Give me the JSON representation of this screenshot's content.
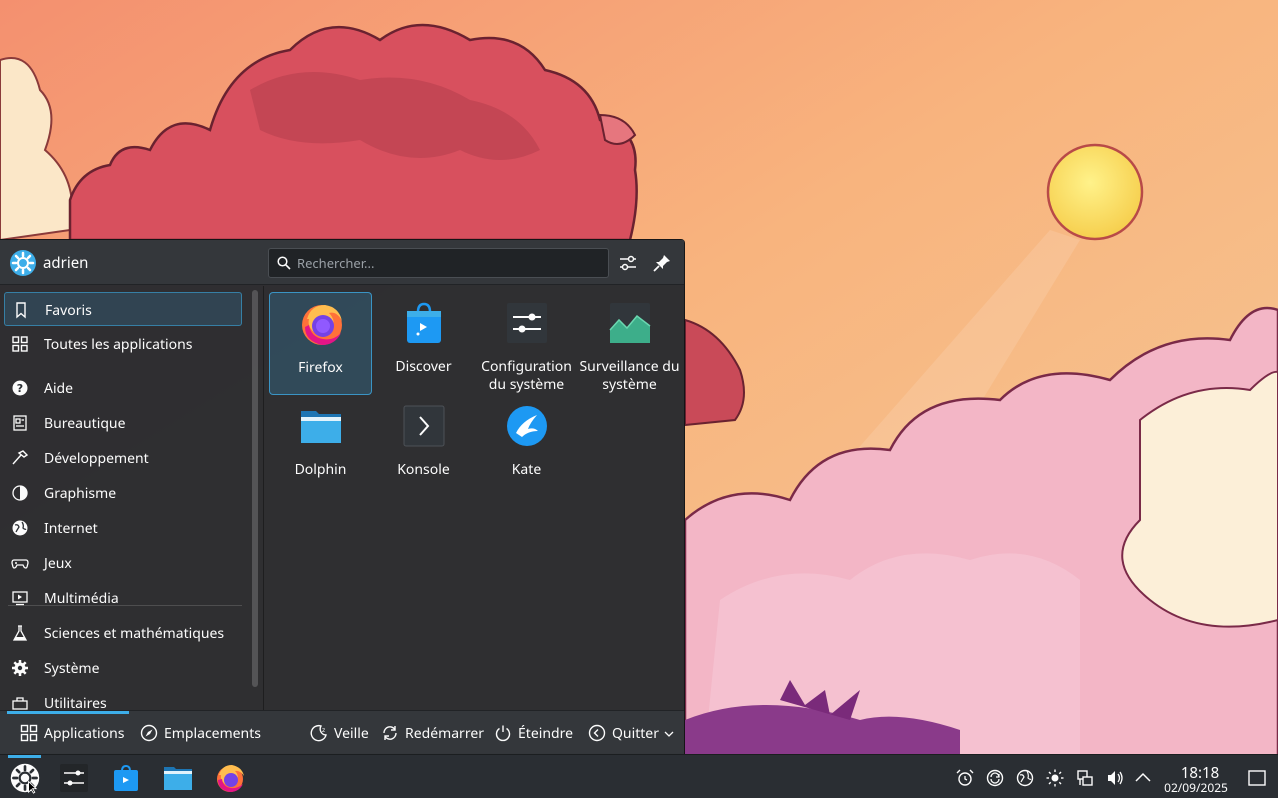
{
  "launcher": {
    "user_name": "adrien",
    "search": {
      "placeholder": "Rechercher..."
    },
    "categories": [
      {
        "label": "Favoris",
        "icon": "bookmark-icon"
      },
      {
        "label": "Toutes les applications",
        "icon": "grid-icon"
      },
      {
        "label": "Aide",
        "icon": "help-icon"
      },
      {
        "label": "Bureautique",
        "icon": "office-icon"
      },
      {
        "label": "Développement",
        "icon": "hammer-icon"
      },
      {
        "label": "Graphisme",
        "icon": "graphics-icon"
      },
      {
        "label": "Internet",
        "icon": "globe-icon"
      },
      {
        "label": "Jeux",
        "icon": "gamepad-icon"
      },
      {
        "label": "Multimédia",
        "icon": "multimedia-icon"
      },
      {
        "label": "Sciences et mathématiques",
        "icon": "flask-icon"
      },
      {
        "label": "Système",
        "icon": "gear-icon"
      },
      {
        "label": "Utilitaires",
        "icon": "utilities-icon"
      }
    ],
    "apps": [
      {
        "label": "Firefox",
        "icon": "firefox-icon"
      },
      {
        "label": "Discover",
        "icon": "discover-icon"
      },
      {
        "label": "Configuration du système",
        "icon": "system-settings-icon"
      },
      {
        "label": "Surveillance du système",
        "icon": "system-monitor-icon"
      },
      {
        "label": "Dolphin",
        "icon": "dolphin-folder-icon"
      },
      {
        "label": "Konsole",
        "icon": "konsole-icon"
      },
      {
        "label": "Kate",
        "icon": "kate-icon"
      }
    ],
    "footer": {
      "applications": "Applications",
      "places": "Emplacements",
      "sleep": "Veille",
      "restart": "Redémarrer",
      "shutdown": "Éteindre",
      "logout": "Quitter"
    }
  },
  "taskbar": {
    "clock_time": "18:18",
    "clock_date": "02/09/2025"
  },
  "colors": {
    "accent": "#3daee9",
    "panel": "#2a2e33",
    "launcher_bg": "#282a2e"
  }
}
